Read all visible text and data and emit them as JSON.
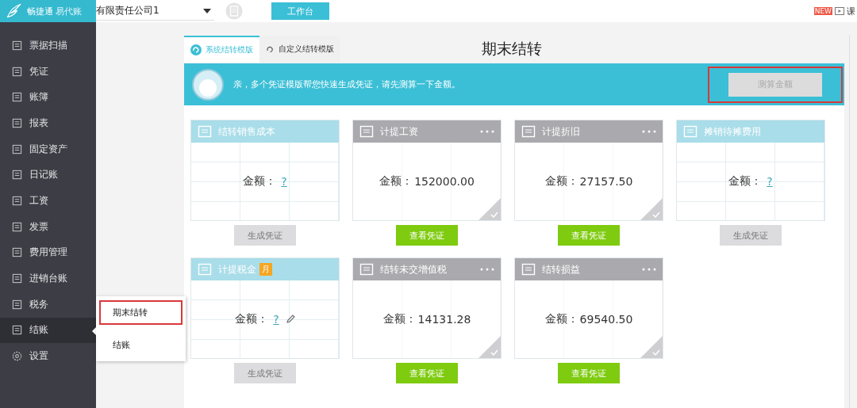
{
  "brand": {
    "name": "畅捷通",
    "product": "易代账"
  },
  "company": {
    "value": "有限责任公司1"
  },
  "workbench_button": "工作台",
  "top_right": {
    "badge": "NEW",
    "label": "课"
  },
  "sidebar": {
    "items": [
      {
        "label": "票据扫描",
        "selected": false
      },
      {
        "label": "凭证",
        "selected": false
      },
      {
        "label": "账簿",
        "selected": false
      },
      {
        "label": "报表",
        "selected": false
      },
      {
        "label": "固定资产",
        "selected": false
      },
      {
        "label": "日记账",
        "selected": false
      },
      {
        "label": "工资",
        "selected": false
      },
      {
        "label": "发票",
        "selected": false
      },
      {
        "label": "费用管理",
        "selected": false
      },
      {
        "label": "进销台账",
        "selected": false
      },
      {
        "label": "税务",
        "selected": false
      },
      {
        "label": "结账",
        "selected": true
      },
      {
        "label": "设置",
        "selected": false
      }
    ]
  },
  "submenu": {
    "items": [
      {
        "label": "期末结转",
        "highlighted": true
      },
      {
        "label": "结账",
        "highlighted": false
      }
    ]
  },
  "tabs": [
    {
      "label": "系统结转模版",
      "selected": true
    },
    {
      "label": "自定义结转模版",
      "selected": false
    }
  ],
  "page_title": "期末结转",
  "banner": {
    "message": "亲，多个凭证模版帮您快速生成凭证，请先测算一下金额。",
    "button": {
      "label": "测算金额",
      "disabled": true,
      "highlighted": true
    }
  },
  "cards": [
    {
      "title": "结转销售成本",
      "amount_label": "金额：",
      "amount": "?",
      "done": false,
      "button": "生成凭证"
    },
    {
      "title": "计提工资",
      "amount_label": "金额：",
      "amount": "152000.00",
      "done": true,
      "button": "查看凭证"
    },
    {
      "title": "计提折旧",
      "amount_label": "金额：",
      "amount": "27157.50",
      "done": true,
      "button": "查看凭证"
    },
    {
      "title": "摊销待摊费用",
      "amount_label": "金额：",
      "amount": "?",
      "done": false,
      "button": "生成凭证"
    },
    {
      "title": "计提税金",
      "badge": "月",
      "amount_label": "金额：",
      "amount": "?",
      "editable": true,
      "done": false,
      "button": "生成凭证"
    },
    {
      "title": "结转未交增值税",
      "amount_label": "金额：",
      "amount": "14131.28",
      "done": true,
      "button": "查看凭证"
    },
    {
      "title": "结转损益",
      "amount_label": "金额：",
      "amount": "69540.50",
      "done": true,
      "button": "查看凭证"
    }
  ]
}
